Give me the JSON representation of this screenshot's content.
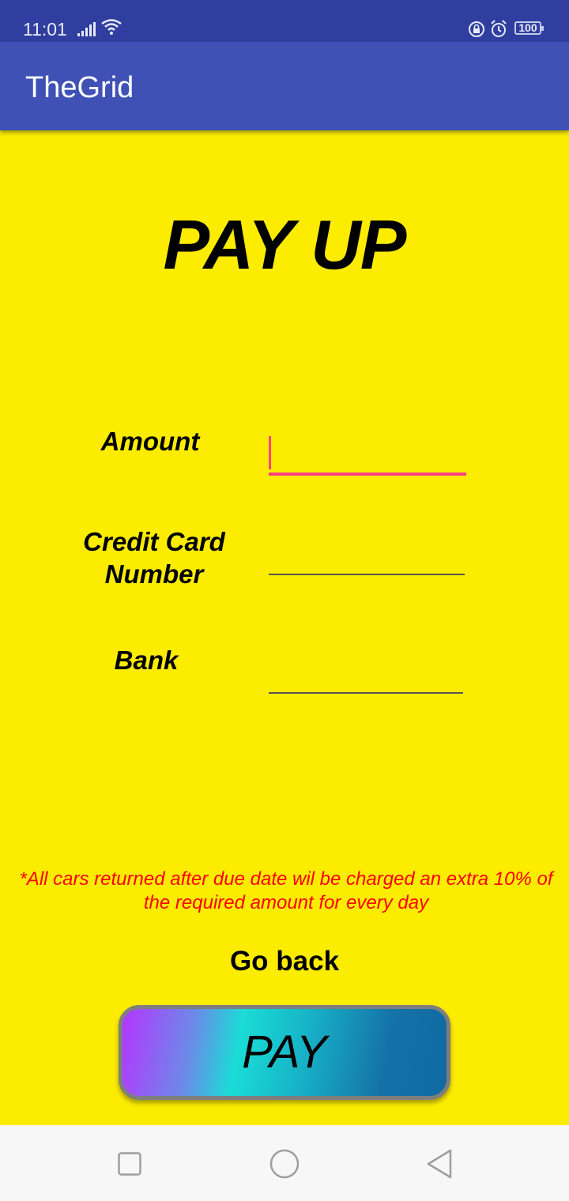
{
  "status_bar": {
    "time": "11:01",
    "battery": "100",
    "icons": [
      "signal-icon",
      "wifi-icon",
      "rotation-lock-icon",
      "alarm-icon",
      "battery-icon"
    ]
  },
  "app_bar": {
    "title": "TheGrid",
    "color": "#3f51b5"
  },
  "main": {
    "background": "#fcec00",
    "heading": "PAY UP",
    "fields": {
      "amount": {
        "label": "Amount",
        "value": "",
        "accent": "#ff4081"
      },
      "card": {
        "label": "Credit Card Number",
        "value": ""
      },
      "bank": {
        "label": "Bank",
        "value": ""
      }
    },
    "notice": "*All cars returned after due date wil be charged an extra 10% of the required amount for every day",
    "notice_color": "#ff0000",
    "go_back": "Go back",
    "pay_button": "PAY"
  },
  "nav_bar": {
    "icons": [
      "recent-apps-icon",
      "home-icon",
      "back-icon"
    ]
  }
}
